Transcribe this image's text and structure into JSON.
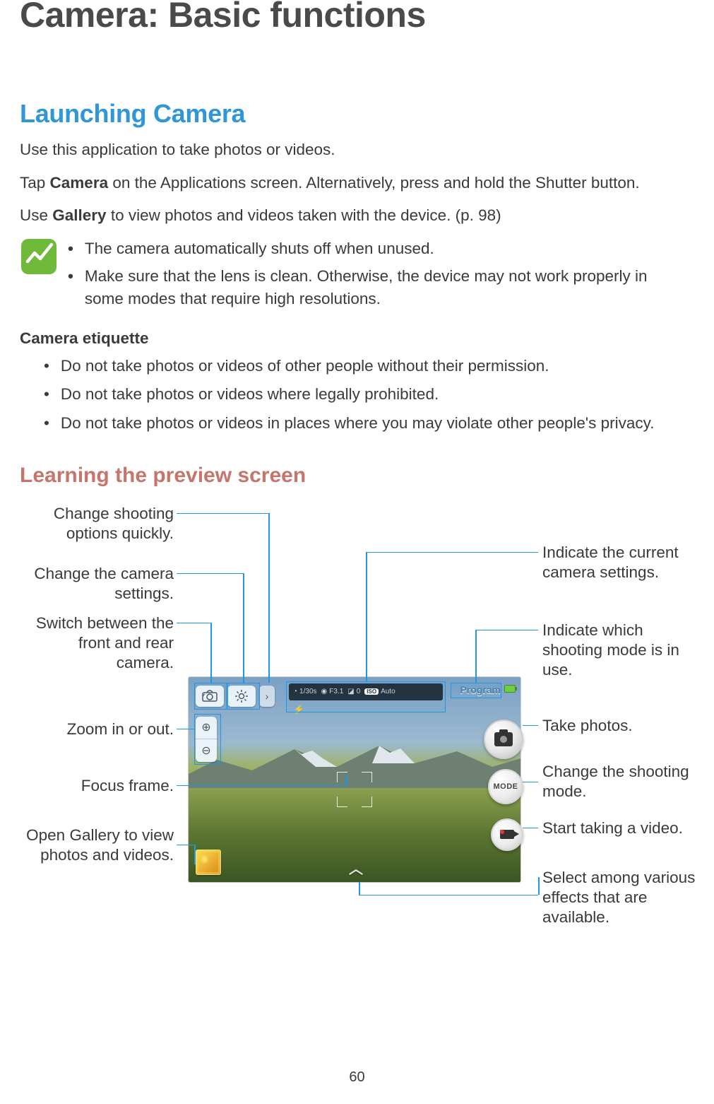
{
  "page_number": "60",
  "title": "Camera: Basic functions",
  "section1": {
    "heading": "Launching Camera",
    "p1": "Use this application to take photos or videos.",
    "p2_pre": "Tap ",
    "p2_b1": "Camera",
    "p2_mid": " on the Applications screen. Alternatively, press and hold the Shutter button.",
    "p3_pre": "Use ",
    "p3_b1": "Gallery",
    "p3_mid": " to view photos and videos taken with the device. (p. 98)",
    "notes": [
      "The camera automatically shuts off when unused.",
      "Make sure that the lens is clean. Otherwise, the device may not work properly in some modes that require high resolutions."
    ],
    "etiquette_heading": "Camera etiquette",
    "etiquette": [
      "Do not take photos or videos of other people without their permission.",
      "Do not take photos or videos where legally prohibited.",
      "Do not take photos or videos in places where you may violate other people's privacy."
    ]
  },
  "section2": {
    "heading": "Learning the preview screen",
    "callouts_left": {
      "quick_options": "Change shooting options quickly.",
      "settings": "Change the camera settings.",
      "switch_cam": "Switch between the front and rear camera.",
      "zoom": "Zoom in or out.",
      "focus": "Focus frame.",
      "gallery": "Open Gallery to view photos and videos."
    },
    "callouts_right": {
      "current_settings": "Indicate the current camera settings.",
      "shooting_mode_indicator": "Indicate which shooting mode is in use.",
      "take_photo": "Take photos.",
      "change_mode": "Change the shooting mode.",
      "start_video": "Start taking a video.",
      "effects": "Select among various effects that are available."
    },
    "screenshot": {
      "settings_bar": {
        "shutter": "1/30s",
        "aperture": "F3.1",
        "exposure": "0",
        "iso_label": "ISO",
        "iso": "Auto"
      },
      "mode_label": "Program",
      "mode_button": "MODE"
    }
  },
  "colors": {
    "blue": "#2f96d8",
    "red": "#c7746a",
    "leader": "#1f97e3"
  }
}
